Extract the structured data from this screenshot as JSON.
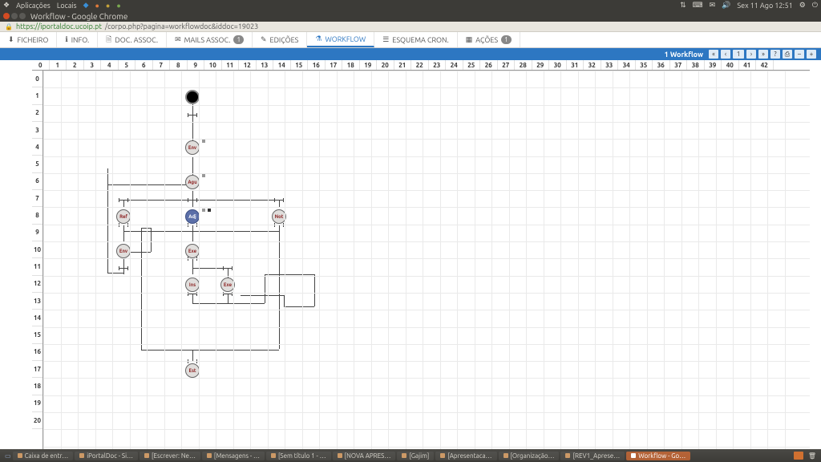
{
  "menubar": {
    "apps": "Aplicações",
    "places": "Locais",
    "clock": "Sex 11 Ago 12:51"
  },
  "window": {
    "title": "Workflow - Google Chrome"
  },
  "url": {
    "host": "https://iportaldoc.ucoip.pt",
    "path": "/corpo.php?pagina=workflowdoc&iddoc=19023"
  },
  "tabs": {
    "ficheiro": "FICHEIRO",
    "info": "INFO.",
    "docassoc": "DOC. ASSOC.",
    "mailsassoc": "MAILS ASSOC.",
    "mails_badge": "1",
    "edicoes": "EDIÇÕES",
    "workflow": "WORKFLOW",
    "esquema": "ESQUEMA CRON.",
    "acoes": "AÇÕES",
    "acoes_badge": "1"
  },
  "toolbar": {
    "label": "1 Workflow",
    "page": "1"
  },
  "nodes": {
    "env1": "Env",
    "agu": "Agu",
    "ref": "Ref",
    "adj": "Adj",
    "not": "Not",
    "env2": "Env",
    "exe1": "Exe",
    "ins": "Ins",
    "exe2": "Exe",
    "est": "Est"
  },
  "ruler_cols": [
    "0",
    "1",
    "2",
    "3",
    "4",
    "5",
    "6",
    "7",
    "8",
    "9",
    "10",
    "11",
    "12",
    "13",
    "14",
    "15",
    "16",
    "17",
    "18",
    "19",
    "20",
    "21",
    "22",
    "23",
    "24",
    "25",
    "26",
    "27",
    "28",
    "29",
    "30",
    "31",
    "32",
    "33",
    "34",
    "35",
    "36",
    "37",
    "38",
    "39",
    "40",
    "41",
    "42"
  ],
  "ruler_rows": [
    "0",
    "1",
    "2",
    "3",
    "4",
    "5",
    "6",
    "7",
    "8",
    "9",
    "10",
    "11",
    "12",
    "13",
    "14",
    "15",
    "16",
    "17",
    "18",
    "19",
    "20"
  ],
  "taskbar": {
    "i0": "Caixa de entr…",
    "i1": "iPortalDoc - Si…",
    "i2": "[Escrever: Ne…",
    "i3": "[Mensagens - …",
    "i4": "[Sem título 1 - …",
    "i5": "[NOVA APRES…",
    "i6": "[Gajim]",
    "i7": "[Apresentaca…",
    "i8": "[Organização…",
    "i9": "[REV1_Aprese…",
    "i10": "Workflow - Go…"
  }
}
